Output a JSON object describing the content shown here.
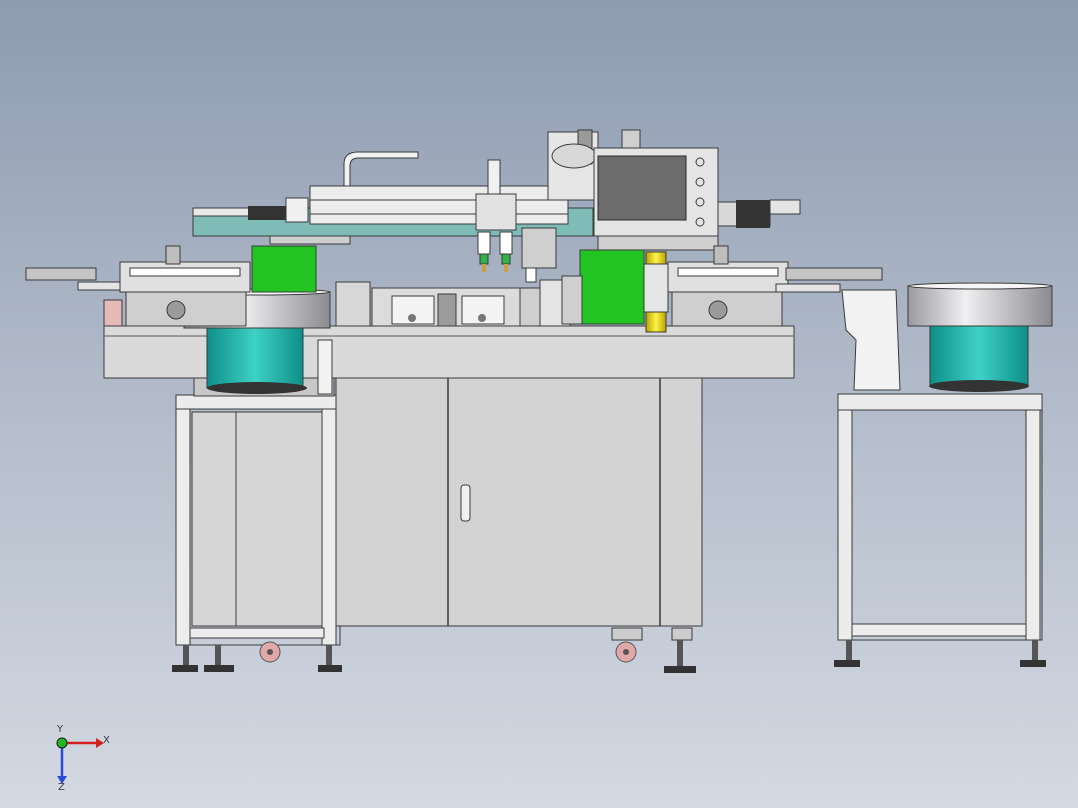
{
  "axis_triad": {
    "x_label": "X",
    "y_label": "Y",
    "z_label": "Z"
  },
  "colors": {
    "background_top": "#8e9bb0",
    "background_bottom": "#d4d9e2",
    "frame": "#e6e6e6",
    "cabinet": "#d2d2d2",
    "green_block": "#22c422",
    "teal_bowl": "#1aa9a0",
    "gantry_teal": "#7fbcb8",
    "yellow_column": "#e8d820",
    "screen": "#6c6c6c",
    "caster_pink": "#e0a8a8"
  }
}
